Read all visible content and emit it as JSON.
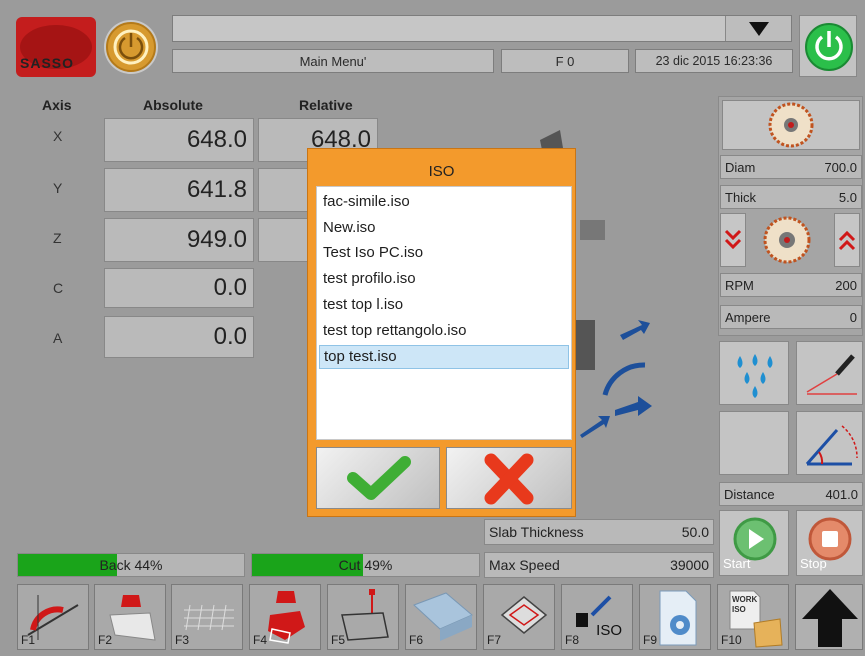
{
  "app": {
    "logo_text": "SASSO"
  },
  "top": {
    "menu_title": "Main Menu'",
    "f_code": "F 0",
    "datetime": "23 dic 2015 16:23:36"
  },
  "axes": {
    "headers": {
      "axis": "Axis",
      "absolute": "Absolute",
      "relative": "Relative"
    },
    "rows": [
      {
        "axis": "X",
        "absolute": "648.0",
        "relative": "648.0"
      },
      {
        "axis": "Y",
        "absolute": "641.8",
        "relative": ""
      },
      {
        "axis": "Z",
        "absolute": "949.0",
        "relative": ""
      },
      {
        "axis": "C",
        "absolute": "0.0",
        "relative": ""
      },
      {
        "axis": "A",
        "absolute": "0.0",
        "relative": ""
      }
    ]
  },
  "right_panel": {
    "diam_label": "Diam",
    "diam_value": "700.0",
    "thick_label": "Thick",
    "thick_value": "5.0",
    "rpm_label": "RPM",
    "rpm_value": "200",
    "ampere_label": "Ampere",
    "ampere_value": "0",
    "distance_label": "Distance",
    "distance_value": "401.0",
    "start_label": "Start",
    "stop_label": "Stop"
  },
  "bottom_info": {
    "slab_label": "Slab Thickness",
    "slab_value": "50.0",
    "speed_label": "Max Speed",
    "speed_value": "39000"
  },
  "progress": {
    "back_label": "Back 44%",
    "back_value": 44,
    "cut_label": "Cut 49%",
    "cut_value": 49,
    "fill_color": "#1aa41a"
  },
  "fkeys": [
    "F1",
    "F2",
    "F3",
    "F4",
    "F5",
    "F6",
    "F7",
    "F8",
    "F9",
    "F10"
  ],
  "f8_caption": "ISO",
  "f10_caption": "WORK\nISO",
  "dialog": {
    "title": "ISO",
    "files": [
      "fac-simile.iso",
      "New.iso",
      "Test Iso PC.iso",
      "test profilo.iso",
      "test top l.iso",
      "test top rettangolo.iso",
      "top test.iso"
    ],
    "selected_index": 6,
    "ok_icon": "checkmark-icon",
    "cancel_icon": "x-cancel-icon"
  },
  "colors": {
    "dialog": "#f39a2c",
    "logo": "#d42020",
    "power_green": "#2bbf4a",
    "power_orange": "#d79a2f",
    "selection": "#cde6f7"
  }
}
